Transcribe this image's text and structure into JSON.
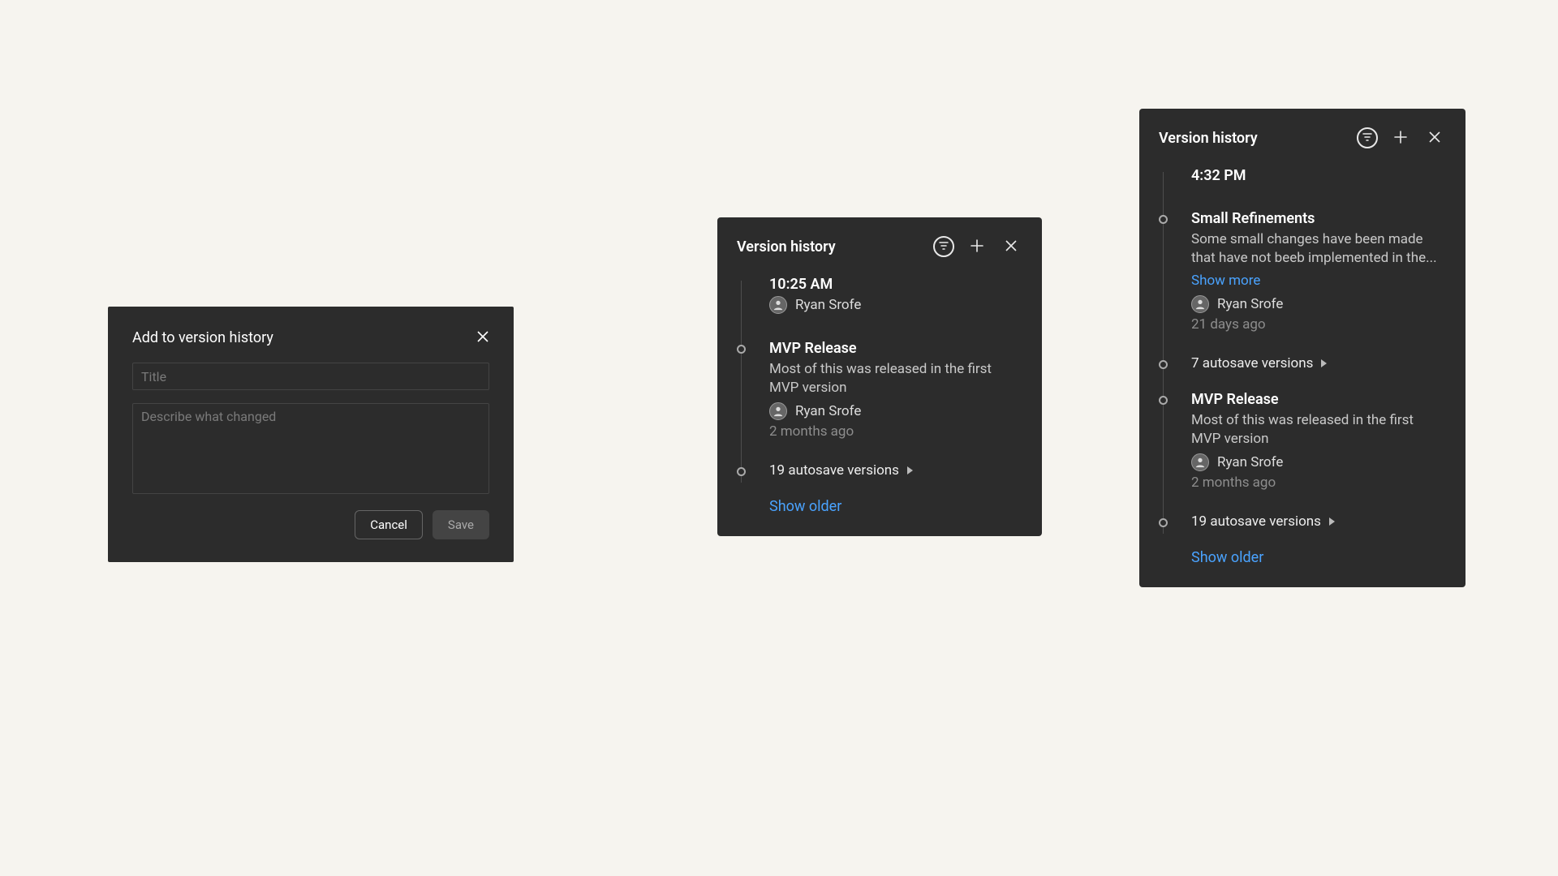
{
  "modal": {
    "title": "Add to version history",
    "title_placeholder": "Title",
    "desc_placeholder": "Describe what changed",
    "cancel": "Cancel",
    "save": "Save"
  },
  "history_a": {
    "title": "Version history",
    "entries": [
      {
        "time": "10:25 AM",
        "user": "Ryan Srofe"
      },
      {
        "title": "MVP Release",
        "desc": "Most of this was released in the first MVP version",
        "user": "Ryan Srofe",
        "ago": "2 months ago"
      }
    ],
    "autosave": "19 autosave versions",
    "show_older": "Show older"
  },
  "history_b": {
    "title": "Version history",
    "entries": [
      {
        "time": "4:32 PM"
      },
      {
        "title": "Small Refinements",
        "desc": "Some small changes have been made that have not beeb implemented in the...",
        "show_more": "Show more",
        "user": "Ryan Srofe",
        "ago": "21 days ago"
      },
      {
        "autosave": "7 autosave versions"
      },
      {
        "title": "MVP Release",
        "desc": "Most of this was released in the first MVP version",
        "user": "Ryan Srofe",
        "ago": "2 months ago"
      },
      {
        "autosave": "19 autosave versions"
      }
    ],
    "show_older": "Show older"
  },
  "icons": {
    "close": "close-icon",
    "filter": "filter-icon",
    "plus": "plus-icon"
  }
}
